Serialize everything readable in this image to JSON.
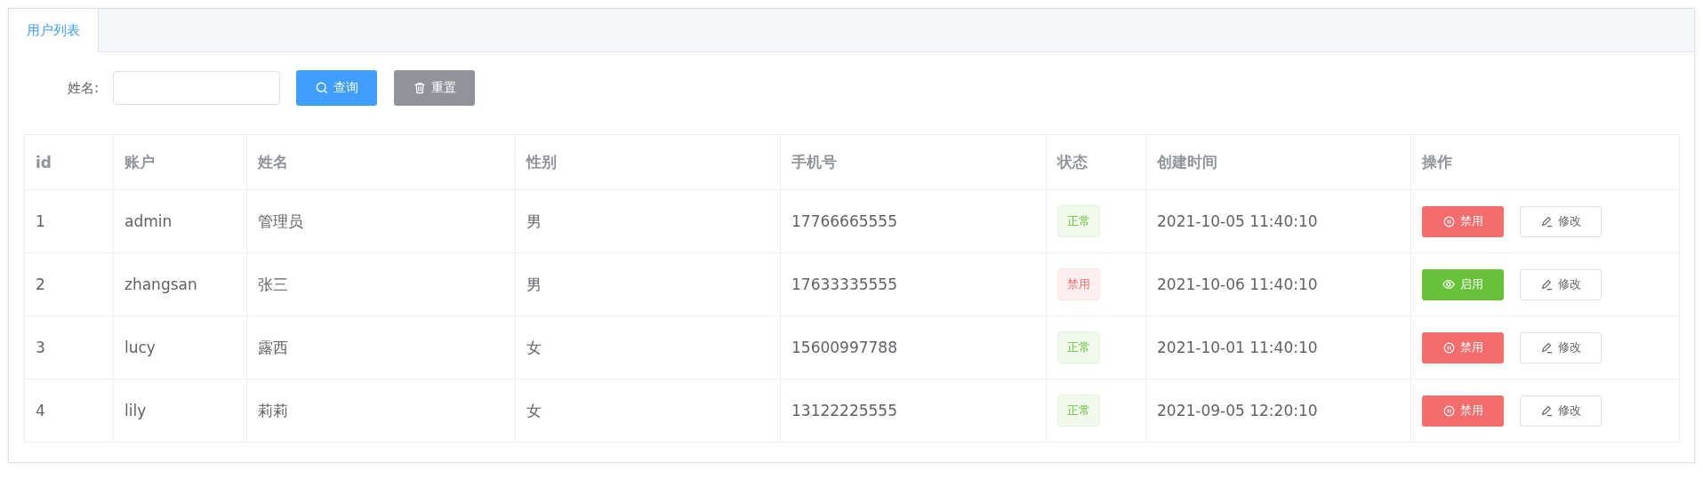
{
  "tabs": [
    {
      "label": "用户列表",
      "selected": true
    }
  ],
  "search": {
    "label": "姓名:",
    "buttons": [
      {
        "text": "查询",
        "kind": "search"
      },
      {
        "text": "重置",
        "kind": "reset"
      }
    ]
  },
  "table": {
    "columns": [
      "id",
      "账户",
      "姓名",
      "性别",
      "手机号",
      "状态",
      "创建时间",
      "操作"
    ],
    "rows": [
      {
        "id": "1",
        "account": "admin",
        "name": "管理员",
        "gender": "男",
        "phone": "17766665555",
        "status": {
          "text": "正常",
          "kind": "normal"
        },
        "created": "2021-10-05 11:40:10",
        "actions": [
          {
            "text": "禁用",
            "kind": "disable"
          },
          {
            "text": "修改",
            "kind": "edit"
          }
        ]
      },
      {
        "id": "2",
        "account": "zhangsan",
        "name": "张三",
        "gender": "男",
        "phone": "17633335555",
        "status": {
          "text": "禁用",
          "kind": "disabled"
        },
        "created": "2021-10-06 11:40:10",
        "actions": [
          {
            "text": "启用",
            "kind": "enable"
          },
          {
            "text": "修改",
            "kind": "edit"
          }
        ]
      },
      {
        "id": "3",
        "account": "lucy",
        "name": "露西",
        "gender": "女",
        "phone": "15600997788",
        "status": {
          "text": "正常",
          "kind": "normal"
        },
        "created": "2021-10-01 11:40:10",
        "actions": [
          {
            "text": "禁用",
            "kind": "disable"
          },
          {
            "text": "修改",
            "kind": "edit"
          }
        ]
      },
      {
        "id": "4",
        "account": "lily",
        "name": "莉莉",
        "gender": "女",
        "phone": "13122225555",
        "status": {
          "text": "正常",
          "kind": "normal"
        },
        "created": "2021-09-05 12:20:10",
        "actions": [
          {
            "text": "禁用",
            "kind": "disable"
          },
          {
            "text": "修改",
            "kind": "edit"
          }
        ]
      }
    ]
  }
}
